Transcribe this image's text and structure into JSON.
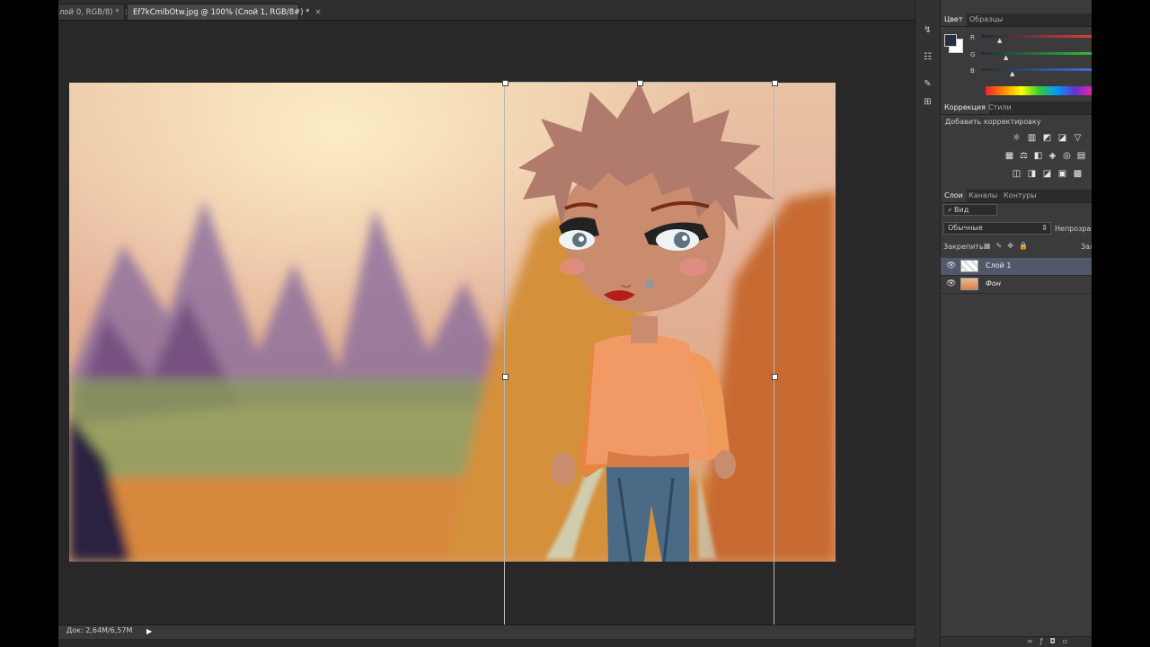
{
  "document_tabs": [
    {
      "label": "лой 0, RGB/8) *",
      "active": false
    },
    {
      "label": "Ef7kCmlbOtw.jpg @ 100% (Слой 1, RGB/8#) *",
      "active": true
    }
  ],
  "tab_close_glyph": "×",
  "status_bar": {
    "doc_size": "Док: 2,64M/6,57M",
    "arrow_glyph": "▶"
  },
  "color_panel": {
    "tabs": [
      "Цвет",
      "Образцы"
    ],
    "channels": [
      {
        "label": "R",
        "color": "#e23b3b"
      },
      {
        "label": "G",
        "color": "#2fbf3a"
      },
      {
        "label": "B",
        "color": "#3b6fe2"
      }
    ],
    "foreground_color": "#253040",
    "background_color": "#ffffff"
  },
  "adjustments_panel": {
    "tabs": [
      "Коррекция",
      "Стили"
    ],
    "subtitle": "Добавить корректировку"
  },
  "layers_panel": {
    "tabs": [
      "Слои",
      "Каналы",
      "Контуры"
    ],
    "filter_label": "Вид",
    "blend_mode": "Обычные",
    "opacity_label": "Непрозрачн",
    "lock_label": "Закрепить:",
    "fill_label": "Зал",
    "layers": [
      {
        "name": "Слой 1",
        "selected": true
      },
      {
        "name": "Фон",
        "selected": false
      }
    ]
  },
  "colors": {
    "workspace": "#282828",
    "panel": "#3b3b3b",
    "selected_layer": "#50586a"
  }
}
